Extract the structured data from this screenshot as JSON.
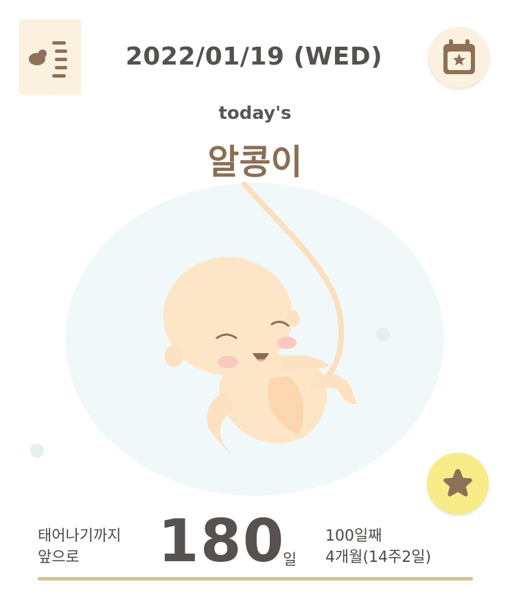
{
  "header": {
    "date": "2022/01/19 (WED)",
    "memo_icon": "memo-list-icon",
    "calendar_icon": "calendar-star-icon"
  },
  "title": {
    "sub": "today's",
    "main": "알콩이"
  },
  "illustration": {
    "icon": "fetus-illustration"
  },
  "favorite": {
    "icon": "star-icon"
  },
  "countdown": {
    "label_line1": "태어나기까지",
    "label_line2": "앞으로",
    "days": "180",
    "unit": "일",
    "day_number": "100일째",
    "month_week": "4개월(14주2일)"
  },
  "colors": {
    "accent_brown": "#8a6e54",
    "cream": "#fbf1de",
    "star_yellow": "#f7ec87",
    "rule_gold": "#d7c392",
    "text_dark": "#555150"
  }
}
